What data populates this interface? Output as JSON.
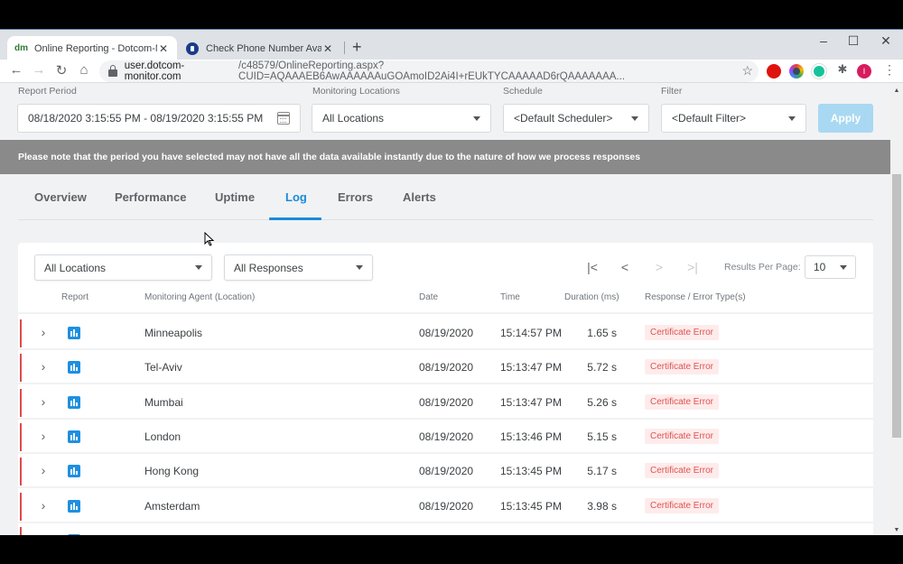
{
  "browser": {
    "tabs": [
      {
        "favicon": "dm",
        "title": "Online Reporting - Dotcom-Monitor",
        "active": true
      },
      {
        "favicon": "phone-check-icon",
        "title": "Check Phone Number Availability",
        "active": false
      }
    ],
    "new_tab": "+",
    "window_controls": {
      "minimize": "–",
      "maximize": "☐",
      "close": "✕"
    },
    "nav": {
      "back": "←",
      "forward": "→",
      "reload": "↻",
      "home": "⌂"
    },
    "url_host": "user.dotcom-monitor.com",
    "url_path": "/c48579/OnlineReporting.aspx?CUID=AQAAAEB6AwAAAAAAuGOAmoID2Ai4I+rEUkTYCAAAAAD6rQAAAAAAA...",
    "bookmark_icon": "☆",
    "extensions": [
      "adblock-icon",
      "color-picker-icon",
      "grammarly-icon",
      "puzzle-icon",
      "profile-avatar",
      "menu-icon"
    ],
    "profile_initial": "I",
    "puzzle": "✱",
    "menu": "⋮"
  },
  "filters": {
    "report_period_label": "Report Period",
    "report_period_value": "08/18/2020 3:15:55 PM - 08/19/2020 3:15:55 PM",
    "locations_label": "Monitoring Locations",
    "locations_value": "All Locations",
    "schedule_label": "Schedule",
    "schedule_value": "<Default Scheduler>",
    "filter_label": "Filter",
    "filter_value": "<Default Filter>",
    "apply_label": "Apply"
  },
  "notice": "Please note that the period you have selected may not have all the data available instantly due to the nature of how we process responses",
  "tabs": [
    {
      "label": "Overview"
    },
    {
      "label": "Performance"
    },
    {
      "label": "Uptime"
    },
    {
      "label": "Log",
      "active": true
    },
    {
      "label": "Errors"
    },
    {
      "label": "Alerts"
    }
  ],
  "log": {
    "location_filter": "All Locations",
    "response_filter": "All Responses",
    "pager": {
      "first": "|<",
      "prev": "<",
      "next": ">",
      "last": ">|"
    },
    "results_per_page_label": "Results Per Page:",
    "results_per_page": "10",
    "columns": [
      "Report",
      "Monitoring Agent (Location)",
      "Date",
      "Time",
      "Duration (ms)",
      "Response / Error Type(s)"
    ],
    "rows": [
      {
        "location": "Minneapolis",
        "date": "08/19/2020",
        "time": "15:14:57 PM",
        "duration": "1.65 s",
        "response": "Certificate Error"
      },
      {
        "location": "Tel-Aviv",
        "date": "08/19/2020",
        "time": "15:13:47 PM",
        "duration": "5.72 s",
        "response": "Certificate Error"
      },
      {
        "location": "Mumbai",
        "date": "08/19/2020",
        "time": "15:13:47 PM",
        "duration": "5.26 s",
        "response": "Certificate Error"
      },
      {
        "location": "London",
        "date": "08/19/2020",
        "time": "15:13:46 PM",
        "duration": "5.15 s",
        "response": "Certificate Error"
      },
      {
        "location": "Hong Kong",
        "date": "08/19/2020",
        "time": "15:13:45 PM",
        "duration": "5.17 s",
        "response": "Certificate Error"
      },
      {
        "location": "Amsterdam",
        "date": "08/19/2020",
        "time": "15:13:45 PM",
        "duration": "3.98 s",
        "response": "Certificate Error"
      },
      {
        "location": "",
        "date": "",
        "time": "",
        "duration": "",
        "response": ""
      }
    ]
  },
  "colors": {
    "accent": "#1a8bd8",
    "error_text": "#e05252",
    "error_bg": "#fdeceb",
    "notice_bg": "#8a8a8a",
    "apply_disabled": "#a9d8f2"
  }
}
